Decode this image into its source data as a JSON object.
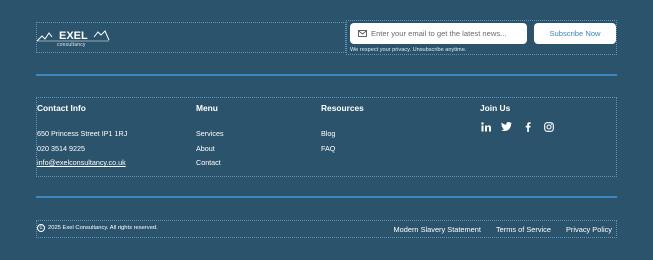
{
  "brand": {
    "name": "EXEL",
    "tagline": "consultancy"
  },
  "signup": {
    "placeholder": "Enter your email to get the latest news...",
    "button": "Subscribe Now",
    "privacy": "We respect your privacy. Unsubscribe anytime."
  },
  "contact": {
    "heading": "Contact Info",
    "address": "650 Princess Street IP1 1RJ",
    "phone": "020 3514 9225",
    "email": "info@exelconsultancy.co.uk"
  },
  "menu": {
    "heading": "Menu",
    "items": [
      "Services",
      "About",
      "Contact"
    ]
  },
  "resources": {
    "heading": "Resources",
    "items": [
      "Blog",
      "FAQ"
    ]
  },
  "social": {
    "heading": "Join Us",
    "icons": [
      "linkedin-icon",
      "twitter-icon",
      "facebook-icon",
      "instagram-icon"
    ]
  },
  "footer": {
    "copyright": "2025 Exel Consultancy. All rights reserved.",
    "links": [
      "Modern Slavery Statement",
      "Terms of Service",
      "Privacy Policy"
    ]
  },
  "colors": {
    "background": "#2b546c",
    "accent": "#3f87c0",
    "text": "#ffffff"
  }
}
